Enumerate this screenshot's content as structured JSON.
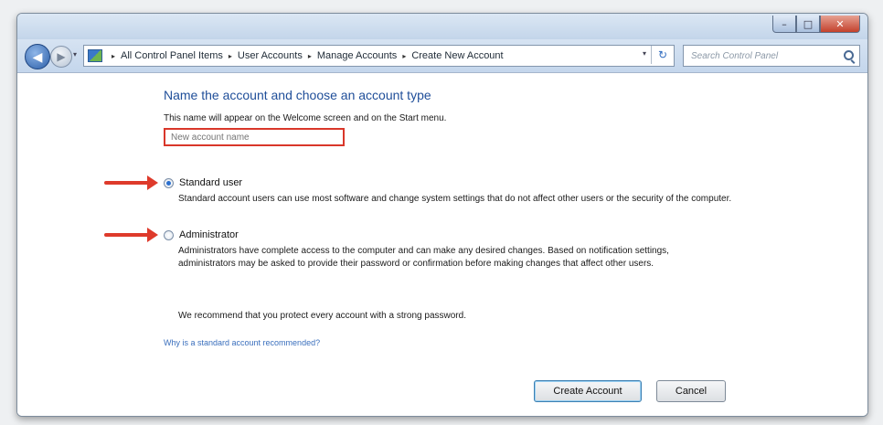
{
  "window": {
    "caption": {
      "minimize": "–",
      "maximize": "□",
      "close": "✕"
    }
  },
  "nav": {
    "back_glyph": "◀",
    "forward_glyph": "▶",
    "dropdown_glyph": "▾",
    "breadcrumbs": [
      "All Control Panel Items",
      "User Accounts",
      "Manage Accounts",
      "Create New Account"
    ],
    "separator": "▸",
    "refresh_glyph": "↻",
    "search_placeholder": "Search Control Panel"
  },
  "main": {
    "heading": "Name the account and choose an account type",
    "description": "This name will appear on the Welcome screen and on the Start menu.",
    "name_input_placeholder": "New account name",
    "standard": {
      "label": "Standard user",
      "checked": true,
      "description": "Standard account users can use most software and change system settings that do not affect other users or the security of the computer."
    },
    "administrator": {
      "label": "Administrator",
      "checked": false,
      "description": "Administrators have complete access to the computer and can make any desired changes. Based on notification settings, administrators may be asked to provide their password or confirmation before making changes that affect other users."
    },
    "recommendation": "We recommend that you protect every account with a strong password.",
    "help_link": "Why is a standard account recommended?"
  },
  "buttons": {
    "create": "Create Account",
    "cancel": "Cancel"
  },
  "colors": {
    "heading": "#1f4e99",
    "annotation": "#de3a2b",
    "link": "#3a6fbd"
  }
}
